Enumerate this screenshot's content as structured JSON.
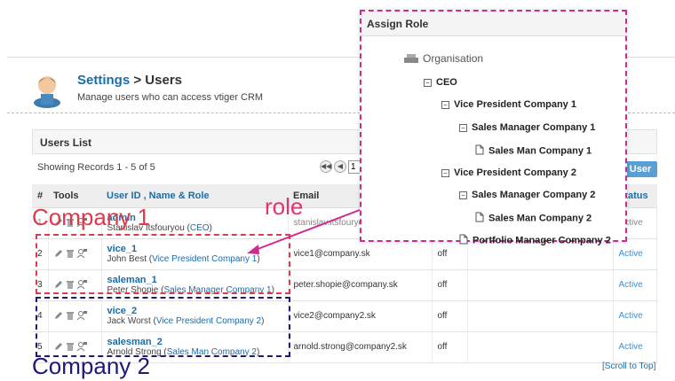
{
  "header": {
    "title_link": "Settings",
    "title_sep": " > ",
    "title_page": "Users",
    "subtitle": "Manage users who can access vtiger CRM"
  },
  "list": {
    "heading": "Users List",
    "showing": "Showing Records 1 - 5 of 5",
    "page_value": "1",
    "add_user": "User"
  },
  "columns": [
    "#",
    "Tools",
    "User ID , Name & Role",
    "Email",
    "",
    "",
    "Status"
  ],
  "users": [
    {
      "num": "1",
      "id": "admin",
      "name": "Stanislav Itsfouryou",
      "role": "CEO",
      "email": "stanislav.itsfouryou",
      "extra": "",
      "status": "Active"
    },
    {
      "num": "2",
      "id": "vice_1",
      "name": "John Best",
      "role": "Vice President Company 1",
      "email": "vice1@company.sk",
      "extra": "off",
      "status": "Active"
    },
    {
      "num": "3",
      "id": "saleman_1",
      "name": "Peter Shopie",
      "role": "Sales Manager Company 1",
      "email": "peter.shopie@company.sk",
      "extra": "off",
      "status": "Active"
    },
    {
      "num": "4",
      "id": "vice_2",
      "name": "Jack Worst",
      "role": "Vice President Company 2",
      "email": "vice2@company2.sk",
      "extra": "off",
      "status": "Active"
    },
    {
      "num": "5",
      "id": "salesman_2",
      "name": "Arnold Strong",
      "role": "Sales Man Company 2",
      "email": "arnold.strong@company2.sk",
      "extra": "off",
      "status": "Active"
    }
  ],
  "annotations": {
    "company1": "Company 1",
    "company2": "Company 2",
    "role": "role",
    "colors": {
      "red": "#e0394d",
      "blue": "#1c1a78",
      "magenta": "#cf2b8e"
    }
  },
  "footer": {
    "scroll_top": "[Scroll to Top]"
  },
  "assign_role": {
    "title": "Assign Role",
    "tree": [
      {
        "label": "Organisation",
        "icon": "org-icon"
      },
      {
        "label": "CEO",
        "icon": "minus-icon"
      },
      {
        "label": "Vice President Company 1",
        "icon": "minus-icon"
      },
      {
        "label": "Sales Manager Company 1",
        "icon": "minus-icon"
      },
      {
        "label": "Sales Man Company 1",
        "icon": "doc-icon"
      },
      {
        "label": "Vice President Company 2",
        "icon": "minus-icon"
      },
      {
        "label": "Sales Manager Company 2",
        "icon": "minus-icon"
      },
      {
        "label": "Sales Man Company 2",
        "icon": "doc-icon"
      },
      {
        "label": "Portfolio Manager Company 2",
        "icon": "doc-icon"
      }
    ]
  }
}
